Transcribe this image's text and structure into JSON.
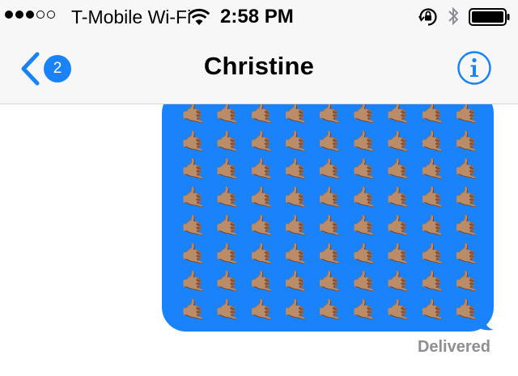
{
  "status_bar": {
    "signal_bars_filled": 3,
    "signal_bars_total": 5,
    "carrier": "T-Mobile Wi-Fi",
    "wifi_icon": "wifi-icon",
    "time": "2:58 PM",
    "orientation_lock_icon": "rotation-lock-icon",
    "bluetooth_icon": "bluetooth-icon",
    "battery_level": 1.0
  },
  "nav": {
    "back_badge": "2",
    "title": "Christine",
    "info_icon": "info-icon",
    "accent_color": "#1a82fb"
  },
  "message": {
    "emoji": "🤙🏽",
    "emoji_rows": 8,
    "emoji_cols": 9,
    "bubble_color": "#1a82fb",
    "status": "Delivered"
  }
}
